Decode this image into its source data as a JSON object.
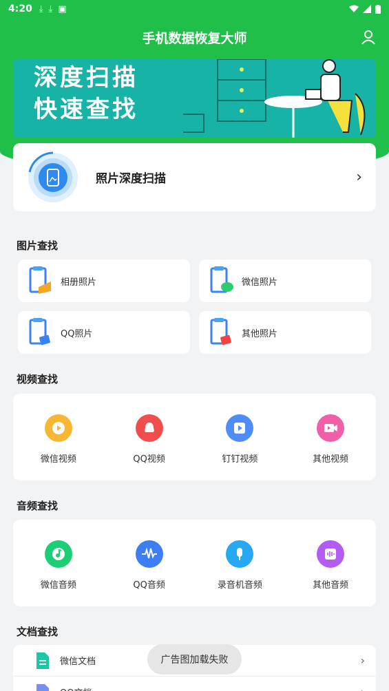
{
  "status": {
    "time": "4:20"
  },
  "app": {
    "title": "手机数据恢复大师"
  },
  "banner": {
    "line1": "深度扫描",
    "line2": "快速查找"
  },
  "scan_card": {
    "label": "照片深度扫描"
  },
  "sections": {
    "photos": "图片查找",
    "videos": "视频查找",
    "audio": "音频查找",
    "docs": "文档查找"
  },
  "photo_tiles": [
    {
      "label": "相册照片",
      "accent": "#f5a623"
    },
    {
      "label": "微信照片",
      "accent": "#2ecc71"
    },
    {
      "label": "QQ照片",
      "accent": "#3b82f6"
    },
    {
      "label": "其他照片",
      "accent": "#ef4444"
    }
  ],
  "video_items": [
    {
      "label": "微信视频",
      "color": "#f7b733",
      "icon": "play-icon"
    },
    {
      "label": "QQ视频",
      "color": "#f24d4d",
      "icon": "qq-icon"
    },
    {
      "label": "钉钉视频",
      "color": "#4f8cf7",
      "icon": "play-icon"
    },
    {
      "label": "其他视频",
      "color": "#f05fa8",
      "icon": "video-icon"
    }
  ],
  "audio_items": [
    {
      "label": "微信音频",
      "color": "#1ccf77",
      "icon": "music-icon"
    },
    {
      "label": "QQ音频",
      "color": "#3d7ef5",
      "icon": "waveform-icon"
    },
    {
      "label": "录音机音频",
      "color": "#26a8f2",
      "icon": "microphone-icon"
    },
    {
      "label": "其他音频",
      "color": "#b35cf2",
      "icon": "audio-icon"
    }
  ],
  "doc_items": [
    {
      "label": "微信文档"
    },
    {
      "label": "QQ文档"
    }
  ],
  "toast": {
    "text": "广告图加载失败"
  }
}
